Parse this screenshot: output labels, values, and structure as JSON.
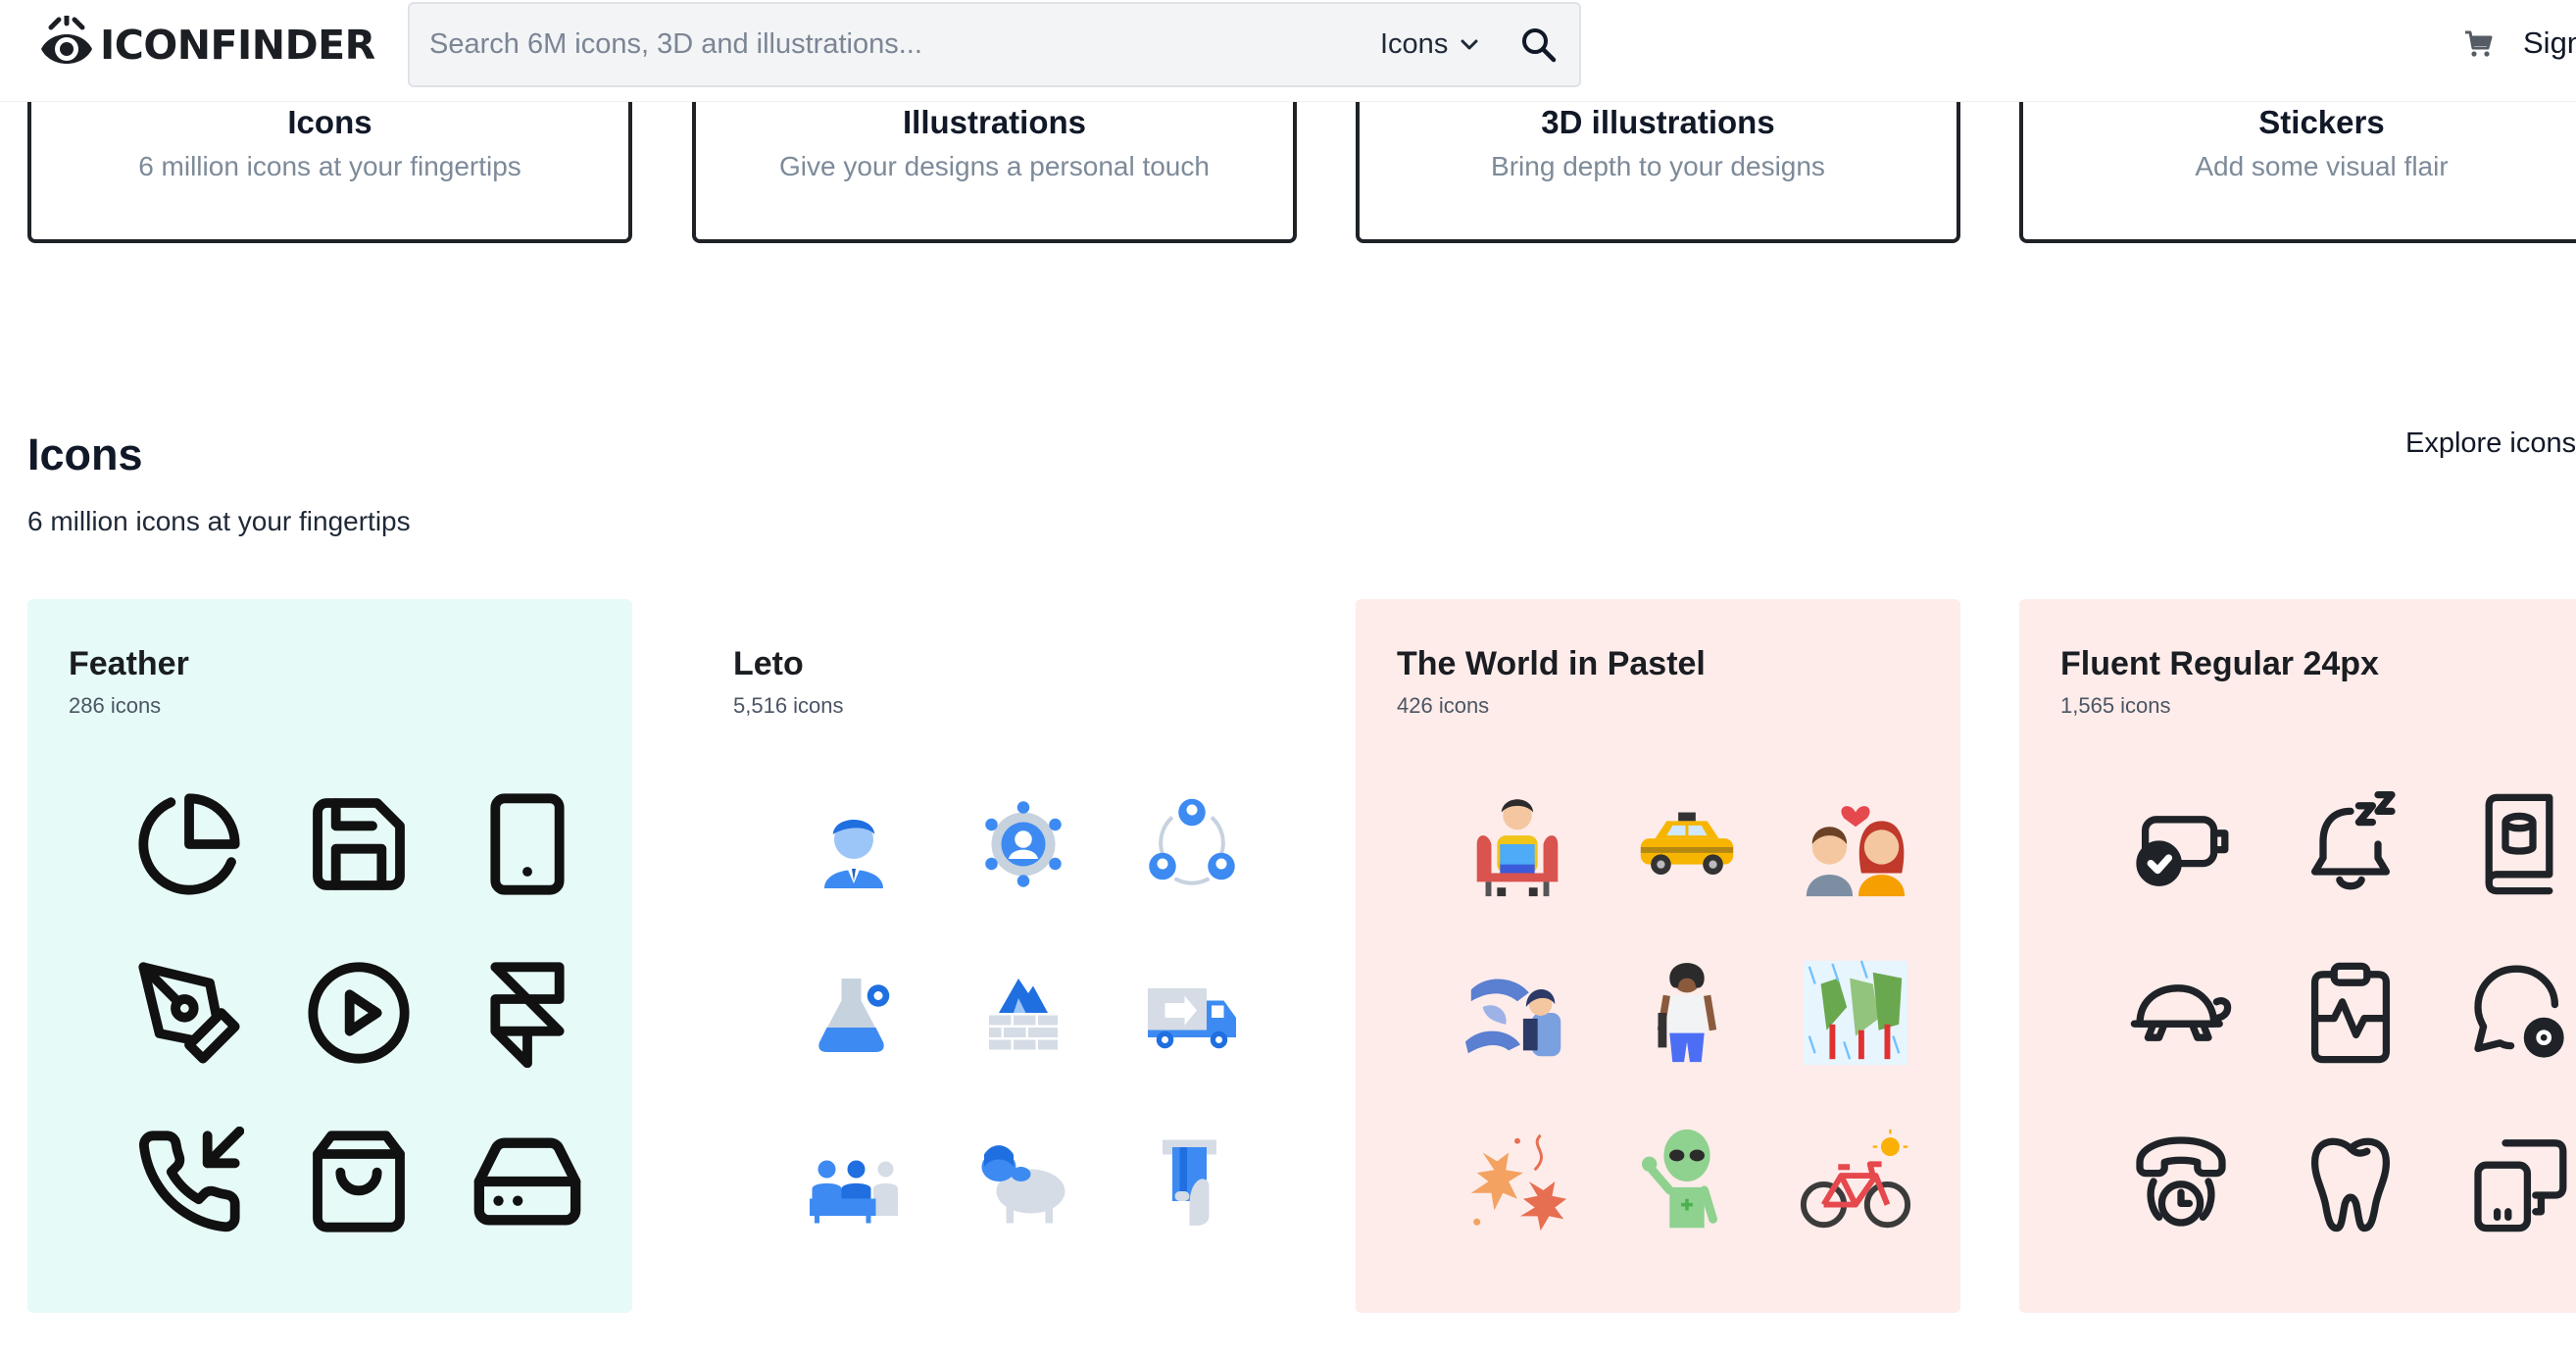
{
  "header": {
    "logo_text": "ICONFINDER",
    "search": {
      "placeholder": "Search 6M icons, 3D and illustrations...",
      "value": "",
      "type_selected": "Icons"
    },
    "signin_label": "Sign"
  },
  "categories": [
    {
      "title": "Icons",
      "subtitle": "6 million icons at your fingertips"
    },
    {
      "title": "Illustrations",
      "subtitle": "Give your designs a personal touch"
    },
    {
      "title": "3D illustrations",
      "subtitle": "Bring depth to your designs"
    },
    {
      "title": "Stickers",
      "subtitle": "Add some visual flair"
    }
  ],
  "section": {
    "title": "Icons",
    "subtitle": "6 million icons at your fingertips",
    "explore_label": "Explore icons"
  },
  "icon_sets": [
    {
      "title": "Feather",
      "count": "286 icons",
      "bg": "#e6fbf8",
      "icons": [
        "pie-chart-icon",
        "save-icon",
        "tablet-icon",
        "pen-tool-icon",
        "play-circle-icon",
        "framer-icon",
        "phone-incoming-icon",
        "shopping-bag-icon",
        "hard-drive-icon"
      ]
    },
    {
      "title": "Leto",
      "count": "5,516 icons",
      "bg": "#ffffff",
      "icons": [
        "businessman-icon",
        "user-network-icon",
        "team-cycle-icon",
        "lab-flask-gear-icon",
        "wall-mountain-icon",
        "delivery-truck-icon",
        "team-group-icon",
        "sheep-icon",
        "card-payment-icon"
      ]
    },
    {
      "title": "The World in Pastel",
      "count": "426 icons",
      "bg": "#fdecea",
      "icons": [
        "person-reading-icon",
        "taxi-icon",
        "couple-love-icon",
        "woman-whales-icon",
        "woman-standing-icon",
        "forest-rain-icon",
        "autumn-leaves-icon",
        "alien-icon",
        "bicycle-icon"
      ]
    },
    {
      "title": "Fluent Regular 24px",
      "count": "1,565 icons",
      "bg": "#fdecea",
      "icons": [
        "battery-checkmark-icon",
        "alert-snooze-icon",
        "book-database-icon",
        "animal-turtle-icon",
        "clipboard-pulse-icon",
        "chat-settings-icon",
        "call-clock-icon",
        "tooth-icon",
        "phone-desktop-icon"
      ]
    }
  ],
  "colors": {
    "feather_bg": "#e6fbf8",
    "pastel_bg": "#fdecea",
    "leto_blue": "#3d8bf2",
    "border_dark": "#1f2328"
  }
}
